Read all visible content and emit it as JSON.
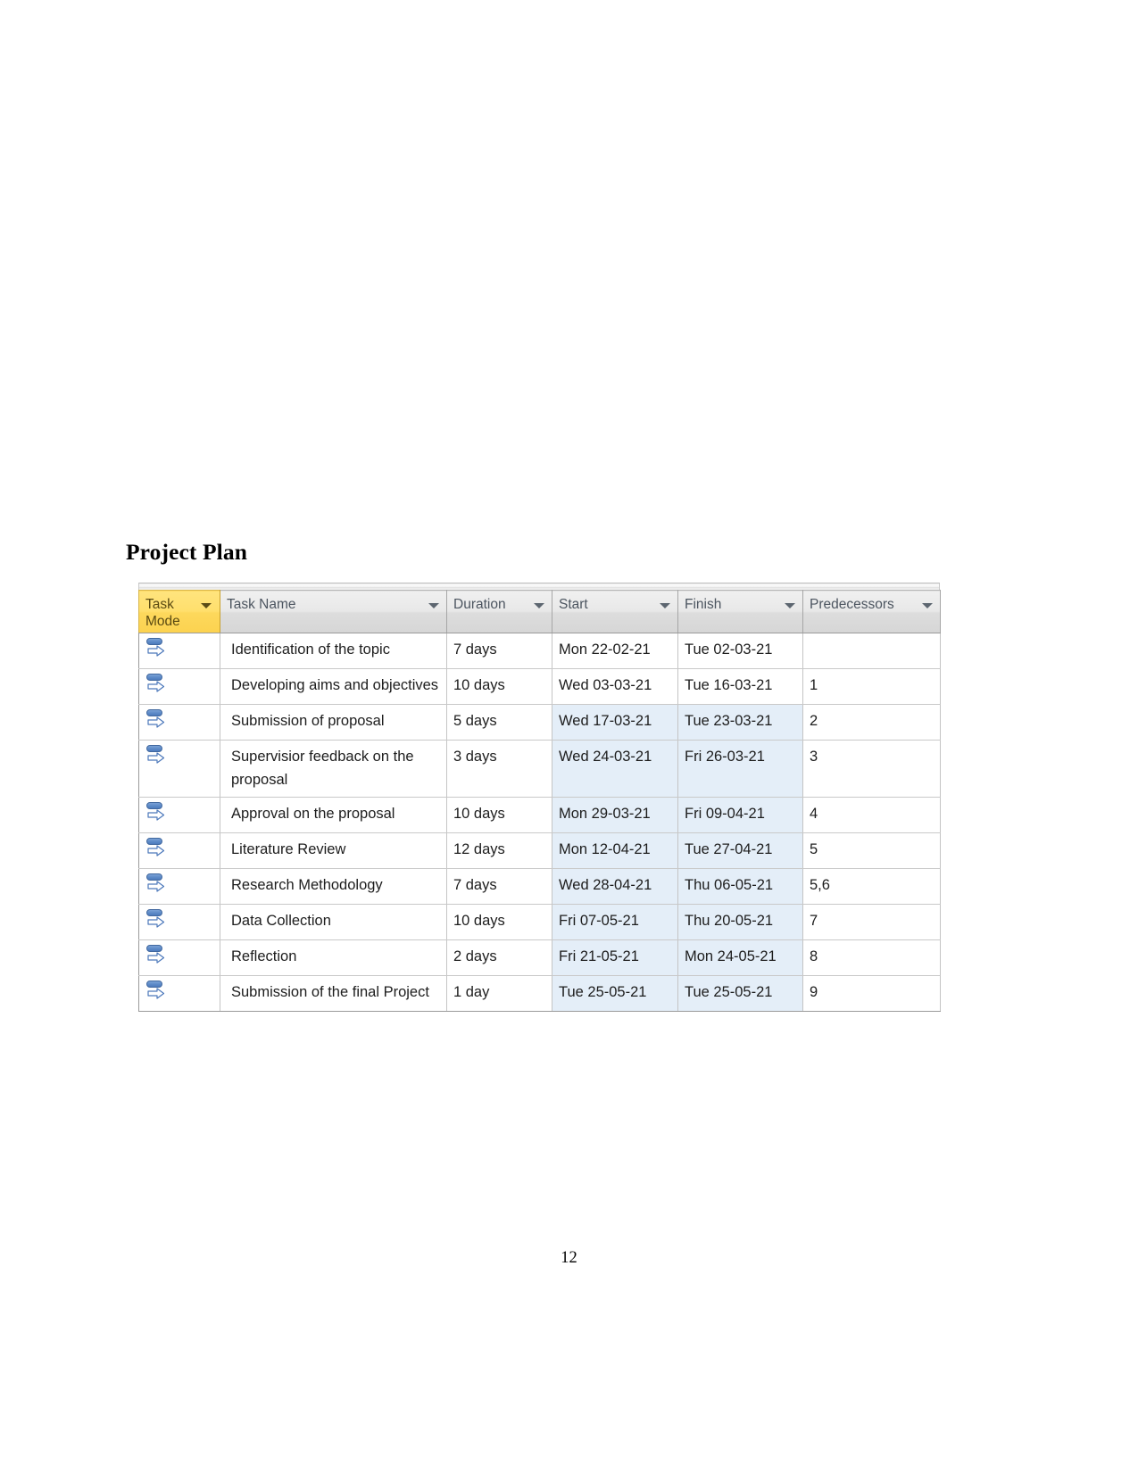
{
  "document": {
    "heading": "Project Plan",
    "page_number": "12"
  },
  "grid": {
    "columns": [
      {
        "key": "task_mode",
        "label": "Task Mode",
        "filter_icon": "chevron-down-icon"
      },
      {
        "key": "task_name",
        "label": "Task Name",
        "filter_icon": "chevron-down-icon"
      },
      {
        "key": "duration",
        "label": "Duration",
        "filter_icon": "chevron-down-icon"
      },
      {
        "key": "start",
        "label": "Start",
        "filter_icon": "chevron-down-icon"
      },
      {
        "key": "finish",
        "label": "Finish",
        "filter_icon": "chevron-down-icon"
      },
      {
        "key": "predecessors",
        "label": "Predecessors",
        "filter_icon": "chevron-down-icon"
      }
    ],
    "header_accent_color": "#fcd85f",
    "selection_color": "#e4eef8",
    "task_mode_icon": "auto-scheduled-icon",
    "rows": [
      {
        "task_name": "Identification of the topic",
        "duration": "7 days",
        "start": "Mon 22-02-21",
        "finish": "Tue 02-03-21",
        "predecessors": "",
        "selected": false
      },
      {
        "task_name": "Developing aims and objectives",
        "duration": "10 days",
        "start": "Wed 03-03-21",
        "finish": "Tue 16-03-21",
        "predecessors": "1",
        "selected": false
      },
      {
        "task_name": "Submission of proposal",
        "duration": "5 days",
        "start": "Wed 17-03-21",
        "finish": "Tue 23-03-21",
        "predecessors": "2",
        "selected": true
      },
      {
        "task_name": "Supervisior feedback on the proposal",
        "duration": "3 days",
        "start": "Wed 24-03-21",
        "finish": "Fri 26-03-21",
        "predecessors": "3",
        "selected": true
      },
      {
        "task_name": "Approval on the proposal",
        "duration": "10 days",
        "start": "Mon 29-03-21",
        "finish": "Fri 09-04-21",
        "predecessors": "4",
        "selected": true
      },
      {
        "task_name": "Literature Review",
        "duration": "12 days",
        "start": "Mon 12-04-21",
        "finish": "Tue 27-04-21",
        "predecessors": "5",
        "selected": true
      },
      {
        "task_name": "Research Methodology",
        "duration": "7 days",
        "start": "Wed 28-04-21",
        "finish": "Thu 06-05-21",
        "predecessors": "5,6",
        "selected": true
      },
      {
        "task_name": "Data Collection",
        "duration": "10 days",
        "start": "Fri 07-05-21",
        "finish": "Thu 20-05-21",
        "predecessors": "7",
        "selected": true
      },
      {
        "task_name": "Reflection",
        "duration": "2 days",
        "start": "Fri 21-05-21",
        "finish": "Mon 24-05-21",
        "predecessors": "8",
        "selected": true
      },
      {
        "task_name": "Submission of the final Project",
        "duration": "1 day",
        "start": "Tue 25-05-21",
        "finish": "Tue 25-05-21",
        "predecessors": "9",
        "selected": true
      }
    ]
  }
}
